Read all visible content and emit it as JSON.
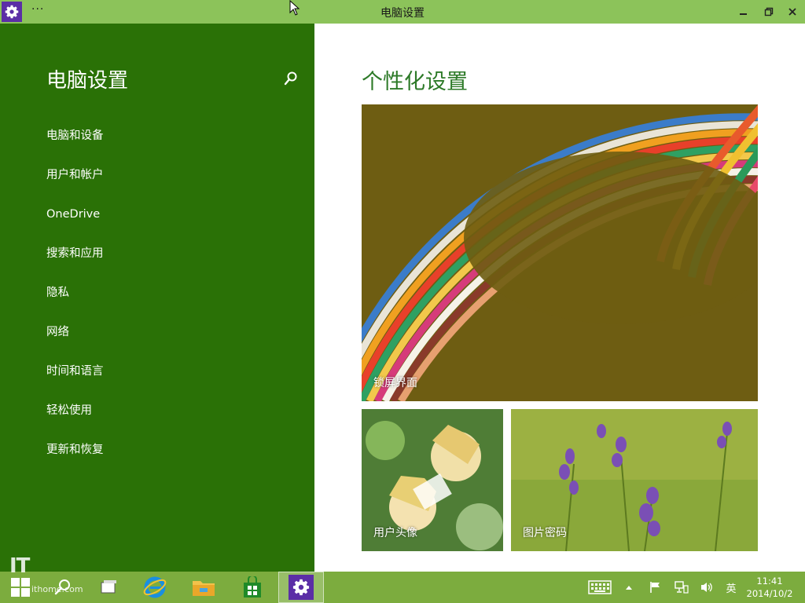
{
  "window": {
    "title": "电脑设置",
    "menu_dots": "···"
  },
  "sidebar": {
    "title": "电脑设置",
    "items": [
      {
        "label": "电脑和设备"
      },
      {
        "label": "用户和帐户"
      },
      {
        "label": "OneDrive"
      },
      {
        "label": "搜索和应用"
      },
      {
        "label": "隐私"
      },
      {
        "label": "网络"
      },
      {
        "label": "时间和语言"
      },
      {
        "label": "轻松使用"
      },
      {
        "label": "更新和恢复"
      }
    ]
  },
  "main": {
    "title": "个性化设置",
    "tiles": {
      "lock_screen": "锁屏界面",
      "account_picture": "用户头像",
      "picture_password": "图片密码"
    }
  },
  "taskbar": {
    "ime": "英",
    "time": "11:41",
    "date": "2014/10/2"
  },
  "watermark": {
    "logo": "IT",
    "site": "ithome.com"
  },
  "colors": {
    "titlebar": "#8cc35a",
    "sidebar": "#2a7106",
    "accent_text": "#2d7a28",
    "taskbar": "#7cac3e",
    "settings_icon_bg": "#5b2ea6"
  },
  "icons": {
    "app": "settings-gear-icon",
    "search": "search-icon",
    "minimize": "minimize-icon",
    "restore": "restore-icon",
    "close": "close-icon"
  }
}
